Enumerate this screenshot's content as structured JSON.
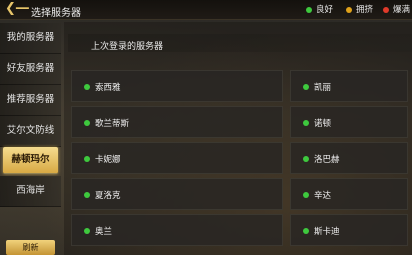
{
  "header": {
    "title": "选择服务器",
    "back_icon": "back-arrow-icon",
    "legend": [
      {
        "label": "良好",
        "color": "#3ec93e"
      },
      {
        "label": "拥挤",
        "color": "#e0a21a"
      },
      {
        "label": "爆满",
        "color": "#e03a2a"
      }
    ]
  },
  "sidebar": {
    "items": [
      {
        "label": "我的服务器",
        "active": false
      },
      {
        "label": "好友服务器",
        "active": false
      },
      {
        "label": "推荐服务器",
        "active": false
      },
      {
        "label": "艾尔文防线",
        "active": false
      },
      {
        "label": "赫顿玛尔",
        "active": true
      },
      {
        "label": "西海岸",
        "active": false
      }
    ],
    "refresh_label": "刷新"
  },
  "main": {
    "section_title": "上次登录的服务器",
    "servers": [
      {
        "name": "索西雅",
        "status_color": "#3ec93e"
      },
      {
        "name": "凯丽",
        "status_color": "#3ec93e"
      },
      {
        "name": "歌兰蒂斯",
        "status_color": "#3ec93e"
      },
      {
        "name": "诺顿",
        "status_color": "#3ec93e"
      },
      {
        "name": "卡妮娜",
        "status_color": "#3ec93e"
      },
      {
        "name": "洛巴赫",
        "status_color": "#3ec93e"
      },
      {
        "name": "夏洛克",
        "status_color": "#3ec93e"
      },
      {
        "name": "辛达",
        "status_color": "#3ec93e"
      },
      {
        "name": "奥兰",
        "status_color": "#3ec93e"
      },
      {
        "name": "斯卡迪",
        "status_color": "#3ec93e"
      }
    ]
  }
}
